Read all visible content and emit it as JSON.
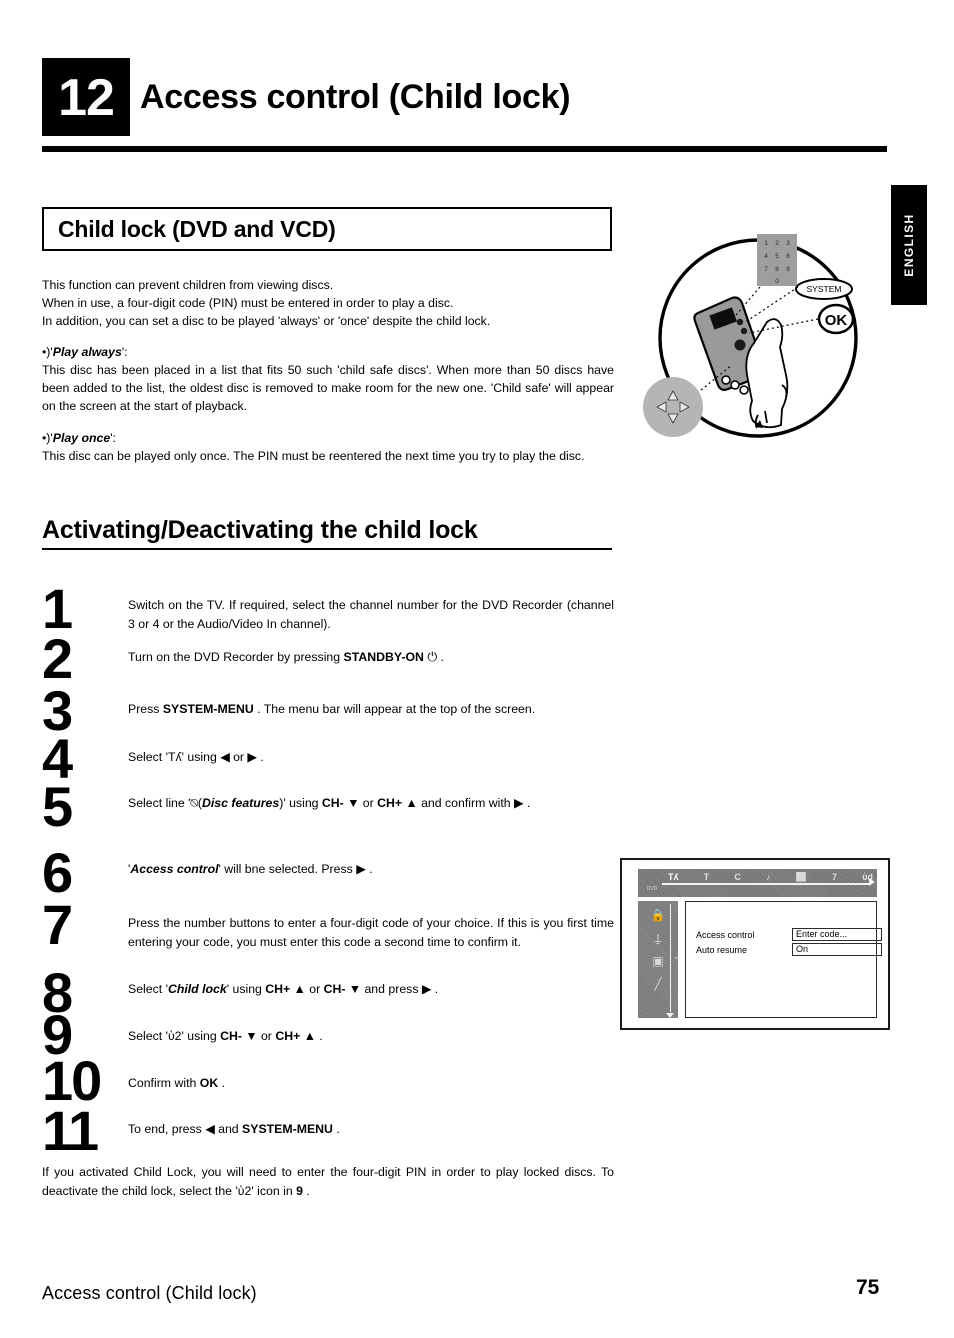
{
  "chapter": {
    "number": "12",
    "title": "Access control (Child lock)"
  },
  "language_tab": "ENGLISH",
  "boxed_heading": "Child lock (DVD and VCD)",
  "intro": {
    "line1": "This function can prevent children from viewing discs.",
    "line2": "When in use, a four-digit code (PIN) must be entered in order to play a disc.",
    "line3": "In addition, you can set a disc to be played 'always' or 'once' despite the child lock."
  },
  "bullets": [
    {
      "marker": "•)",
      "title": "Play always",
      "title_prefix": "'",
      "title_suffix": "':",
      "body": "This disc has been placed in a list that fits 50 such 'child safe discs'. When more than 50 discs have been added to the list, the oldest disc is removed to make room for the new one. 'Child safe' will appear on the screen at the start of playback."
    },
    {
      "marker": "•)",
      "title": "Play once",
      "title_prefix": "'",
      "title_suffix": "':",
      "body": "This disc can be played only once. The PIN must be reentered the next time you try to play the disc."
    }
  ],
  "section_heading": "Activating/Deactivating the child lock",
  "steps": [
    {
      "num": "1",
      "text_html": "Switch on the TV. If required, select the channel number for the DVD Recorder (channel 3 or 4 or the Audio/Video In channel)."
    },
    {
      "num": "2",
      "text_html": "Turn on the DVD Recorder by pressing  <b>STANDBY-ON</b> ⏻ ."
    },
    {
      "num": "3",
      "text_html": "Press  <b>SYSTEM-MENU</b> . The menu bar will appear at the top of the screen."
    },
    {
      "num": "4",
      "text_html": "Select '<span class=\"gl-tools\">Tʎ</span>' using ◀ or ▶ ."
    },
    {
      "num": "5",
      "text_html": "Select line '<span class=\"gl-disc\">⍉</span>(<i class=\"bi\">Disc features</i>)' using  <b>CH-</b> ▼ or  <b>CH+</b> ▲ and confirm with ▶ ."
    },
    {
      "num": "6",
      "text_html": "'<i class=\"bi\">Access control</i>' will bne selected. Press ▶ ."
    },
    {
      "num": "7",
      "text_html": "Press the number buttons to enter a four-digit code of your choice. If this is you first time entering your code, you must enter this code a second time to confirm it."
    },
    {
      "num": "8",
      "text_html": "Select '<i class=\"bi\">Child lock</i>' using  <b>CH+</b> ▲ or  <b>CH-</b> ▼ and press ▶ ."
    },
    {
      "num": "9",
      "text_html": "Select '<span class=\"gl-lock\">ὑ2</span>' using  <b>CH-</b> ▼ or  <b>CH+</b> ▲ ."
    },
    {
      "num": "10",
      "text_html": "Confirm with  <b>OK</b> ."
    },
    {
      "num": "11",
      "text_html": "To end, press ◀ and  <b>SYSTEM-MENU</b> ."
    }
  ],
  "closing_note_html": "If you activated Child Lock, you will need to enter the four-digit PIN in order to play locked discs. To deactivate the child lock, select the '<span class=\"gl-lock\">ὑ2</span>' icon in <b>9</b> .",
  "remote_illustration": {
    "callout_numpad_keys": [
      "1",
      "2",
      "3",
      "4",
      "5",
      "6",
      "7",
      "8",
      "9",
      "0"
    ],
    "callout_system": "SYSTEM",
    "callout_ok": "OK",
    "callout_dpad": "navigation-arrows"
  },
  "tv_screen": {
    "menubar_icons": [
      "Tʎ",
      "T",
      "C",
      "♪",
      "⬜",
      "὏7",
      "ὐd"
    ],
    "menubar_tag": "DVD",
    "sidebar_icons": [
      "lock-icon",
      "disc-features-icon",
      "picture-icon",
      "pen-icon"
    ],
    "rows": [
      {
        "label": "Access control",
        "value": "Enter code..."
      },
      {
        "label": "Auto resume",
        "value": "On"
      }
    ]
  },
  "footer": {
    "title": "Access control (Child lock)",
    "page": "75"
  }
}
